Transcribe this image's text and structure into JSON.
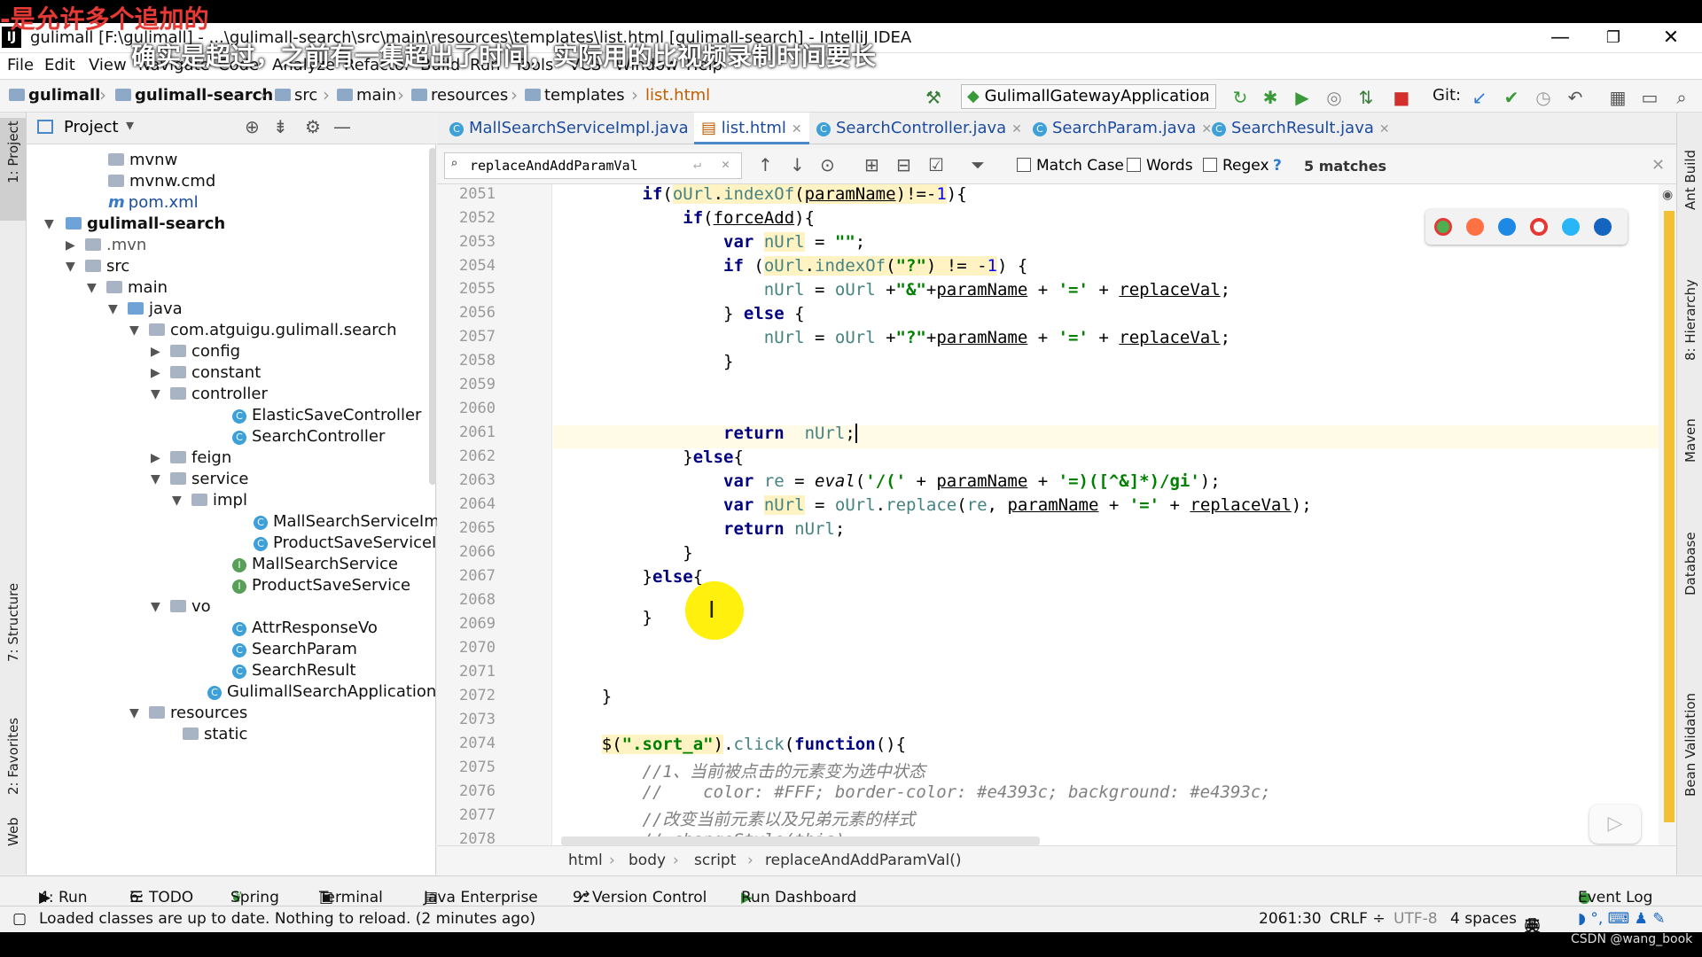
{
  "window": {
    "title": "gulimall [F:\\gulimall] - ...\\gulimall-search\\src\\main\\resources\\templates\\list.html [gulimall-search] - IntelliJ IDEA",
    "overlay_top": "-是允许多个追加的",
    "overlay_subtitle": "确实是超过，之前有一集超出了时间，实际用的比视频录制时间要长"
  },
  "menu": [
    "File",
    "Edit",
    "View",
    "Navigate",
    "Code",
    "Analyze",
    "Refactor",
    "Build",
    "Run",
    "Tools",
    "VCS",
    "Window",
    "Help"
  ],
  "nav": {
    "crumbs": [
      "gulimall",
      "gulimall-search",
      "src",
      "main",
      "resources",
      "templates",
      "list.html"
    ],
    "run_config": "GulimallGatewayApplication",
    "git_label": "Git:"
  },
  "left_strip": {
    "project": "1: Project",
    "structure": "7: Structure",
    "favorites": "2: Favorites",
    "web": "Web"
  },
  "right_strip": {
    "ant": "Ant Build",
    "hierarchy": "8: Hierarchy",
    "maven": "Maven",
    "database": "Database",
    "bean": "Bean Validation"
  },
  "project_panel": {
    "title": "Project",
    "tree": [
      {
        "label": "mvnw"
      },
      {
        "label": "mvnw.cmd"
      },
      {
        "label": "pom.xml"
      },
      {
        "label": "gulimall-search"
      },
      {
        "label": ".mvn"
      },
      {
        "label": "src"
      },
      {
        "label": "main"
      },
      {
        "label": "java"
      },
      {
        "label": "com.atguigu.gulimall.search"
      },
      {
        "label": "config"
      },
      {
        "label": "constant"
      },
      {
        "label": "controller"
      },
      {
        "label": "ElasticSaveController"
      },
      {
        "label": "SearchController"
      },
      {
        "label": "feign"
      },
      {
        "label": "service"
      },
      {
        "label": "impl"
      },
      {
        "label": "MallSearchServiceImp"
      },
      {
        "label": "ProductSaveServiceIm"
      },
      {
        "label": "MallSearchService"
      },
      {
        "label": "ProductSaveService"
      },
      {
        "label": "vo"
      },
      {
        "label": "AttrResponseVo"
      },
      {
        "label": "SearchParam"
      },
      {
        "label": "SearchResult"
      },
      {
        "label": "GulimallSearchApplication"
      },
      {
        "label": "resources"
      },
      {
        "label": "static"
      }
    ]
  },
  "tabs": [
    {
      "label": "MallSearchServiceImpl.java"
    },
    {
      "label": "list.html"
    },
    {
      "label": "SearchController.java"
    },
    {
      "label": "SearchParam.java"
    },
    {
      "label": "SearchResult.java"
    }
  ],
  "search": {
    "query": "replaceAndAddParamVal",
    "match_case": "Match Case",
    "words": "Words",
    "regex": "Regex",
    "help": "?",
    "matches": "5 matches"
  },
  "editor": {
    "line_numbers": [
      "2051",
      "2052",
      "2053",
      "2054",
      "2055",
      "2056",
      "2057",
      "2058",
      "2059",
      "2060",
      "2061",
      "2062",
      "2063",
      "2064",
      "2065",
      "2066",
      "2067",
      "2068",
      "2069",
      "2070",
      "2071",
      "2072",
      "2073",
      "2074",
      "2075",
      "2076",
      "2077",
      "2078"
    ]
  },
  "editor_crumbs": [
    "html",
    "body",
    "script",
    "replaceAndAddParamVal()"
  ],
  "bottom_tools": [
    "4: Run",
    "6: TODO",
    "Spring",
    "Terminal",
    "Java Enterprise",
    "9: Version Control",
    "Run Dashboard",
    "Event Log"
  ],
  "status": {
    "message": "Loaded classes are up to date. Nothing to reload. (2 minutes ago)",
    "position": "2061:30",
    "line_sep": "CRLF ÷",
    "encoding": "UTF-8",
    "indent": "4 spaces",
    "ime": "英"
  },
  "watermark": "CSDN @wang_book"
}
